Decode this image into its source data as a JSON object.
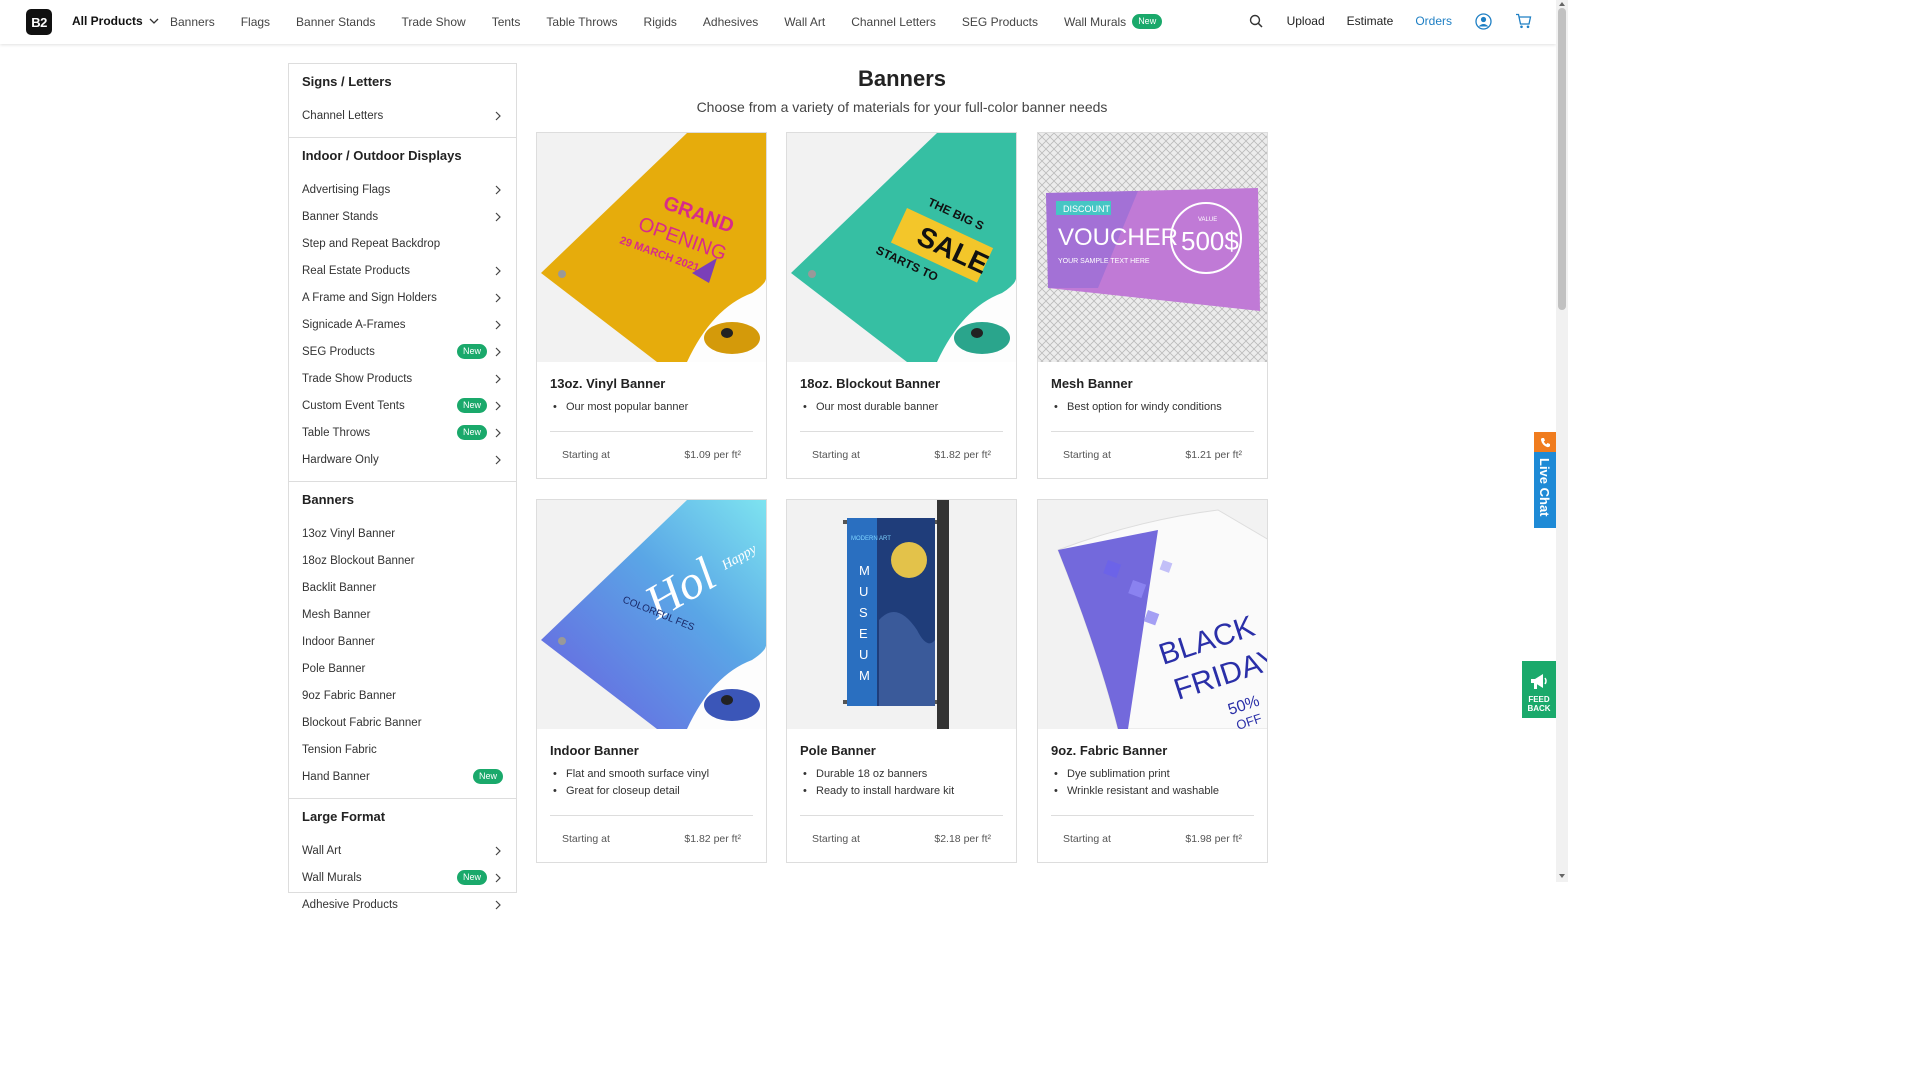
{
  "nav": {
    "logo": "B2",
    "all_products": "All Products",
    "links": [
      {
        "label": "Banners",
        "badge": ""
      },
      {
        "label": "Flags",
        "badge": ""
      },
      {
        "label": "Banner Stands",
        "badge": ""
      },
      {
        "label": "Trade Show",
        "badge": ""
      },
      {
        "label": "Tents",
        "badge": ""
      },
      {
        "label": "Table Throws",
        "badge": ""
      },
      {
        "label": "Rigids",
        "badge": ""
      },
      {
        "label": "Adhesives",
        "badge": ""
      },
      {
        "label": "Wall Art",
        "badge": ""
      },
      {
        "label": "Channel Letters",
        "badge": ""
      },
      {
        "label": "SEG Products",
        "badge": ""
      },
      {
        "label": "Wall Murals",
        "badge": "New"
      }
    ],
    "upload": "Upload",
    "estimate": "Estimate",
    "orders": "Orders"
  },
  "sidebar": {
    "sections": [
      {
        "heading": "Signs / Letters",
        "items": [
          {
            "label": "Channel Letters",
            "badge": "",
            "chevron": true
          }
        ]
      },
      {
        "heading": "Indoor / Outdoor Displays",
        "items": [
          {
            "label": "Advertising Flags",
            "badge": "",
            "chevron": true
          },
          {
            "label": "Banner Stands",
            "badge": "",
            "chevron": true
          },
          {
            "label": "Step and Repeat Backdrop",
            "badge": "",
            "chevron": false
          },
          {
            "label": "Real Estate Products",
            "badge": "",
            "chevron": true
          },
          {
            "label": "A Frame and Sign Holders",
            "badge": "",
            "chevron": true
          },
          {
            "label": "Signicade A-Frames",
            "badge": "",
            "chevron": true
          },
          {
            "label": "SEG Products",
            "badge": "New",
            "chevron": true
          },
          {
            "label": "Trade Show Products",
            "badge": "",
            "chevron": true
          },
          {
            "label": "Custom Event Tents",
            "badge": "New",
            "chevron": true
          },
          {
            "label": "Table Throws",
            "badge": "New",
            "chevron": true
          },
          {
            "label": "Hardware Only",
            "badge": "",
            "chevron": true
          }
        ]
      },
      {
        "heading": "Banners",
        "items": [
          {
            "label": "13oz Vinyl Banner",
            "badge": "",
            "chevron": false
          },
          {
            "label": "18oz Blockout Banner",
            "badge": "",
            "chevron": false
          },
          {
            "label": "Backlit Banner",
            "badge": "",
            "chevron": false
          },
          {
            "label": "Mesh Banner",
            "badge": "",
            "chevron": false
          },
          {
            "label": "Indoor Banner",
            "badge": "",
            "chevron": false
          },
          {
            "label": "Pole Banner",
            "badge": "",
            "chevron": false
          },
          {
            "label": "9oz Fabric Banner",
            "badge": "",
            "chevron": false
          },
          {
            "label": "Blockout Fabric Banner",
            "badge": "",
            "chevron": false
          },
          {
            "label": "Tension Fabric",
            "badge": "",
            "chevron": false
          },
          {
            "label": "Hand Banner",
            "badge": "New",
            "chevron": false
          }
        ]
      },
      {
        "heading": "Large Format",
        "items": [
          {
            "label": "Wall Art",
            "badge": "",
            "chevron": true
          },
          {
            "label": "Wall Murals",
            "badge": "New",
            "chevron": true
          },
          {
            "label": "Adhesive Products",
            "badge": "",
            "chevron": true
          }
        ]
      }
    ]
  },
  "main": {
    "title": "Banners",
    "subtitle": "Choose from a variety of materials for your full-color banner needs",
    "starting_at": "Starting at",
    "cards": [
      {
        "title": "13oz. Vinyl Banner",
        "bullets": [
          "Our most popular banner"
        ],
        "price": "$1.09 per ft²",
        "image_text": [
          "GRAND",
          "OPENING",
          "29 MARCH 2021"
        ]
      },
      {
        "title": "18oz. Blockout Banner",
        "bullets": [
          "Our most durable banner"
        ],
        "price": "$1.82 per ft²",
        "image_text": [
          "THE BIG S",
          "SALE",
          "STARTS TO"
        ]
      },
      {
        "title": "Mesh Banner",
        "bullets": [
          "Best option for windy conditions"
        ],
        "price": "$1.21 per ft²",
        "image_text": [
          "DISCOUNT",
          "VOUCHER",
          "YOUR SAMPLE TEXT HERE",
          "VALUE",
          "500$"
        ]
      },
      {
        "title": "Indoor Banner",
        "bullets": [
          "Flat and smooth surface vinyl",
          "Great for closeup detail"
        ],
        "price": "$1.82 per ft²",
        "image_text": [
          "Happy",
          "Hol",
          "COLORFUL FES"
        ]
      },
      {
        "title": "Pole Banner",
        "bullets": [
          "Durable 18 oz banners",
          "Ready to install hardware kit"
        ],
        "price": "$2.18 per ft²",
        "image_text": [
          "MODERN ART",
          "M",
          "U",
          "S",
          "E",
          "U",
          "M"
        ]
      },
      {
        "title": "9oz. Fabric Banner",
        "bullets": [
          "Dye sublimation print",
          "Wrinkle resistant and washable"
        ],
        "price": "$1.98 per ft²",
        "image_text": [
          "BLACK",
          "FRIDAY",
          "50%",
          "OFF"
        ]
      }
    ]
  },
  "widgets": {
    "live_chat": "Live Chat",
    "feedback_line1": "FEED",
    "feedback_line2": "BACK"
  },
  "colors": {
    "accent_blue": "#1e7fc4",
    "badge_green": "#1aa96b",
    "vinyl_yellow": "#e6ac0c",
    "blockout_teal": "#36bfa3",
    "mesh_purple": "#c07ad6",
    "indoor_blue": "#5a8fe6",
    "pole_blue": "#2a6fc0",
    "fabric_purple": "#5b4fd6"
  }
}
